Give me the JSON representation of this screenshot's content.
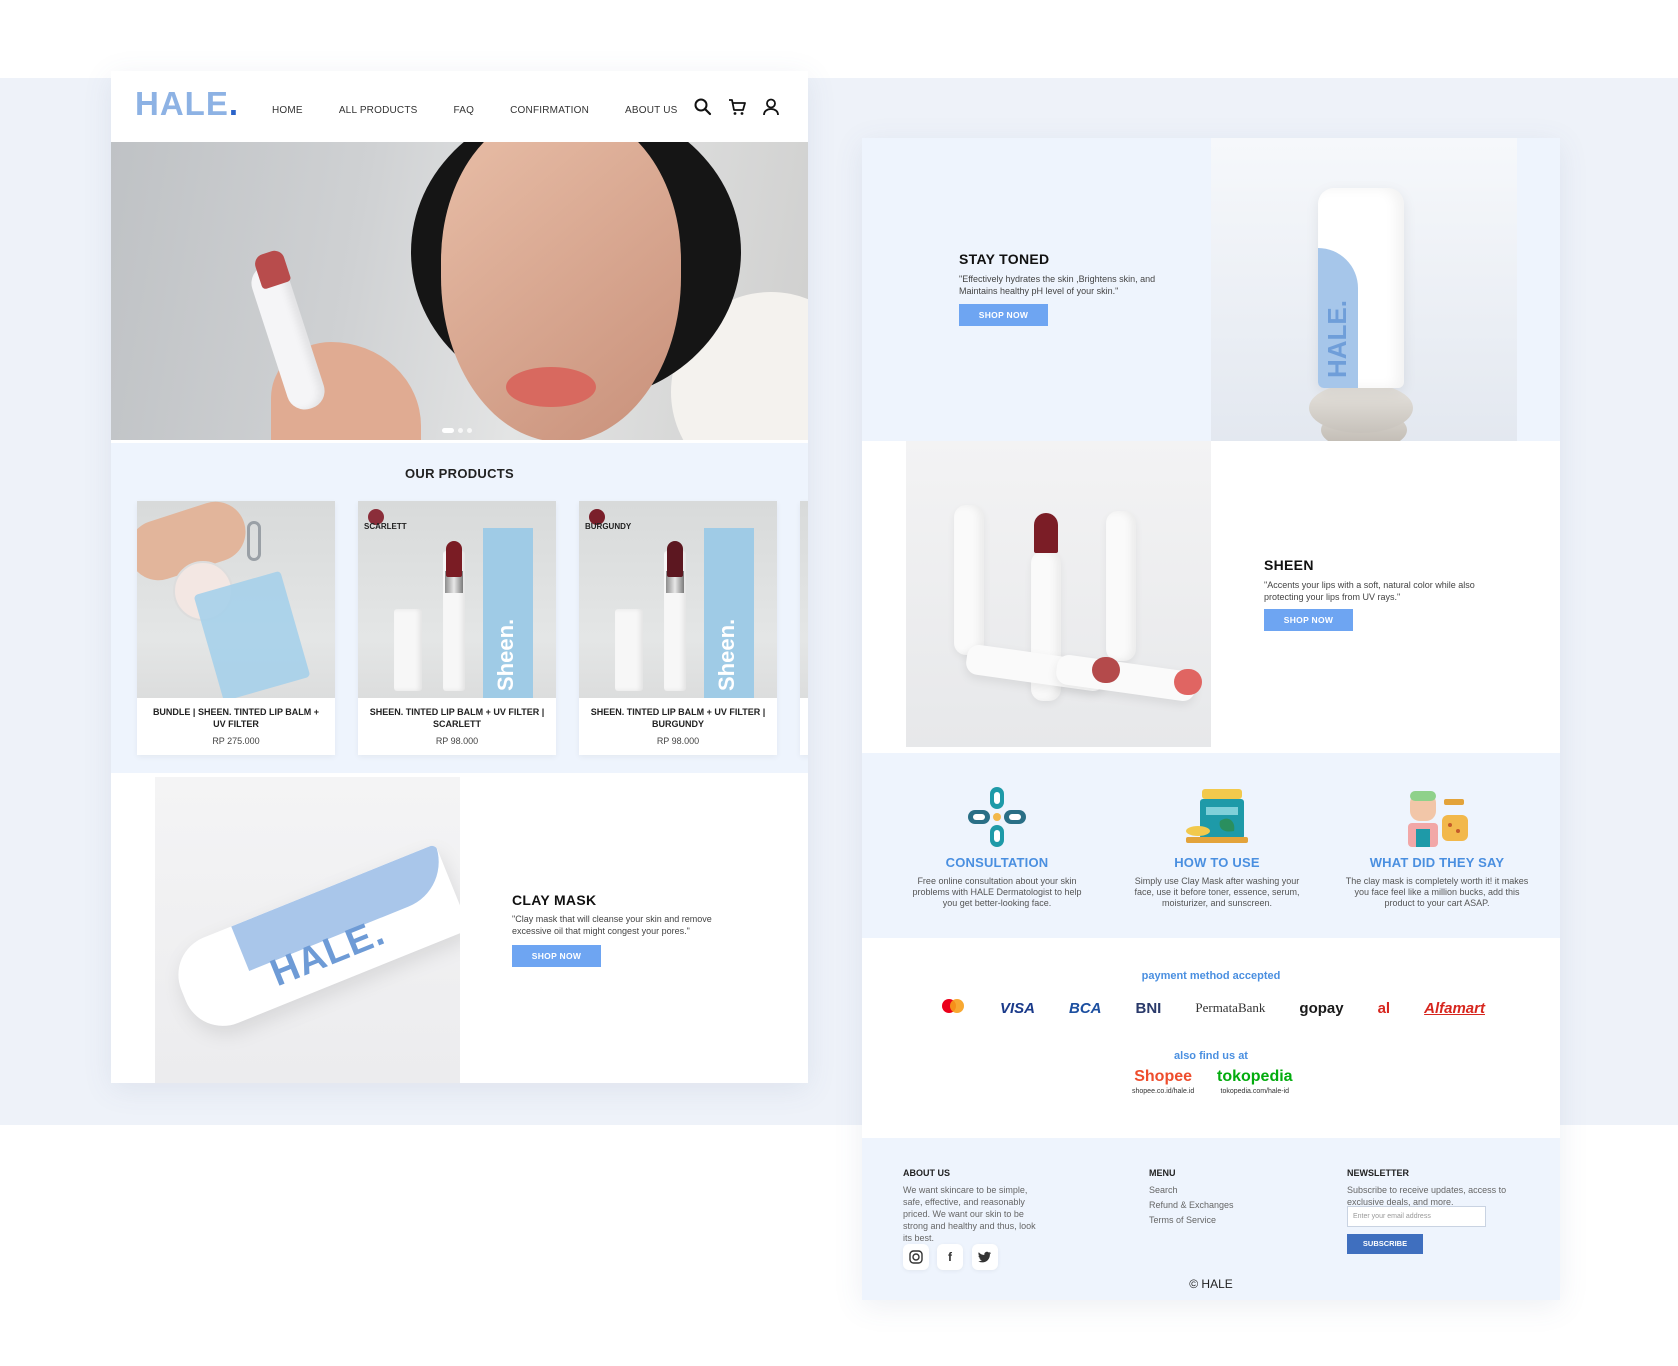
{
  "header": {
    "logo": "HALE",
    "logo_dot": ".",
    "nav": [
      "HOME",
      "ALL PRODUCTS",
      "FAQ",
      "CONFIRMATION",
      "ABOUT US"
    ],
    "icons": [
      "search-icon",
      "cart-icon",
      "user-icon"
    ]
  },
  "hero": {
    "slides_total": 3,
    "active_slide": 1
  },
  "products": {
    "title": "OUR PRODUCTS",
    "items": [
      {
        "name": "BUNDLE | SHEEN. TINTED LIP BALM + UV  FILTER",
        "price": "RP 275.000",
        "shade": ""
      },
      {
        "name": "SHEEN. TINTED LIP BALM + UV FILTER | SCARLETT",
        "price": "RP 98.000",
        "shade": "SCARLETT"
      },
      {
        "name": "SHEEN. TINTED LIP BALM + UV FILTER | BURGUNDY",
        "price": "RP 98.000",
        "shade": "BURGUNDY"
      }
    ],
    "box_text": "Sheen."
  },
  "clay": {
    "title": "CLAY MASK",
    "desc": "\"Clay mask that will cleanse your skin and remove excessive oil that might congest your pores.\"",
    "button": "SHOP NOW",
    "tube_logo": "HALE."
  },
  "toned": {
    "title": "STAY TONED",
    "desc": "\"Effectively hydrates the skin ,Brightens skin, and Maintains healthy pH level of your skin.\"",
    "button": "SHOP NOW",
    "bottle_logo": "HALE."
  },
  "sheen": {
    "title": "SHEEN",
    "desc": "\"Accents your lips with a soft, natural color while also protecting your lips from UV rays.\"",
    "button": "SHOP NOW"
  },
  "info": [
    {
      "title": "CONSULTATION",
      "desc": "Free online consultation about your skin problems with HALE Dermatologist to help you get better-looking face.",
      "icon": "consultation-icon"
    },
    {
      "title": "HOW TO USE",
      "desc": "Simply use Clay Mask after washing your face, use it before toner, essence, serum, moisturizer, and sunscreen.",
      "icon": "products-icon"
    },
    {
      "title": "WHAT DID THEY SAY",
      "desc": "The clay mask is completely worth it! it makes you face feel like a million bucks, add this product to your cart ASAP.",
      "icon": "testimonial-icon"
    }
  ],
  "payment": {
    "title": "payment method accepted",
    "methods": [
      "VISA",
      "BCA",
      "BNI",
      "PermataBank",
      "gopay",
      "al",
      "Alfamart"
    ],
    "colors": {
      "visa": "#1a3a8a",
      "bca": "#1c4fa0",
      "bni": "#f26522",
      "permata": "#333333",
      "gopay": "#1fa2d8",
      "al": "#d7261e",
      "alfamart": "#d7261e"
    }
  },
  "stores": {
    "title": "also find us at",
    "shopee": {
      "name": "Shopee",
      "url": "shopee.co.id/hale.id"
    },
    "tokopedia": {
      "name": "tokopedia",
      "url": "tokopedia.com/hale-id"
    }
  },
  "footer": {
    "about_head": "ABOUT US",
    "about_text": "We want skincare to be simple, safe, effective, and reasonably priced. We want our skin to be strong and healthy and thus, look its best.",
    "menu_head": "MENU",
    "menu": [
      "Search",
      "Refund & Exchanges",
      "Terms of Service"
    ],
    "news_head": "NEWSLETTER",
    "news_text": "Subscribe to receive updates, access to exclusive deals, and more.",
    "email_placeholder": "Enter your email address",
    "subscribe": "SUBSCRIBE",
    "social": [
      "instagram-icon",
      "facebook-icon",
      "twitter-icon"
    ],
    "copyright": "©  HALE"
  },
  "colors": {
    "accent": "#6ea5f2",
    "title_blue": "#4a8fe0",
    "logo": "#8db2e4",
    "section_bg": "#eef4fd"
  }
}
